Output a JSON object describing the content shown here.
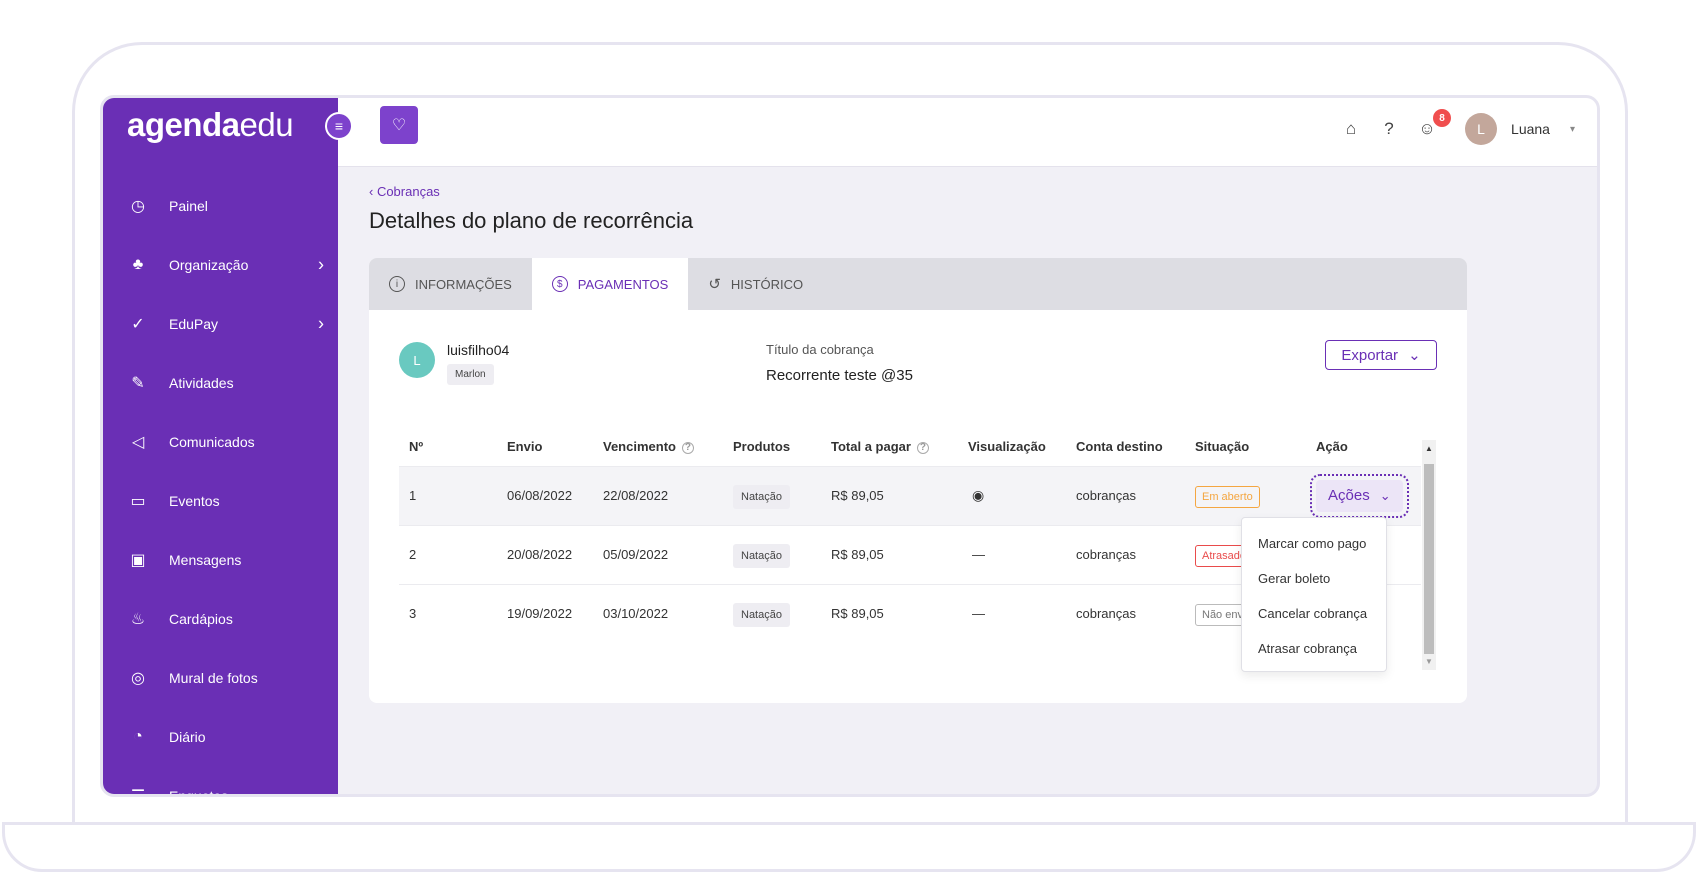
{
  "sidebar": {
    "logo_bold": "agenda",
    "logo_light": "edu",
    "toggle_icon": "≡",
    "items": [
      {
        "label": "Painel",
        "icon": "dashboard-icon",
        "glyph": "◷",
        "chevron": ""
      },
      {
        "label": "Organização",
        "icon": "hierarchy-icon",
        "glyph": "♣",
        "chevron": "›"
      },
      {
        "label": "EduPay",
        "icon": "check-icon",
        "glyph": "✓",
        "chevron": "›"
      },
      {
        "label": "Atividades",
        "icon": "pencil-icon",
        "glyph": "✎",
        "chevron": ""
      },
      {
        "label": "Comunicados",
        "icon": "megaphone-icon",
        "glyph": "◁",
        "chevron": ""
      },
      {
        "label": "Eventos",
        "icon": "calendar-icon",
        "glyph": "▭",
        "chevron": ""
      },
      {
        "label": "Mensagens",
        "icon": "chat-icon",
        "glyph": "▣",
        "chevron": ""
      },
      {
        "label": "Cardápios",
        "icon": "cutlery-icon",
        "glyph": "♨",
        "chevron": ""
      },
      {
        "label": "Mural de fotos",
        "icon": "camera-icon",
        "glyph": "◎",
        "chevron": ""
      },
      {
        "label": "Diário",
        "icon": "timer-icon",
        "glyph": "◔",
        "chevron": ""
      },
      {
        "label": "Enquetes",
        "icon": "list-icon",
        "glyph": "☰",
        "chevron": ""
      }
    ]
  },
  "topbar": {
    "brand_glyph": "♡",
    "gift_glyph": "⌂",
    "help_glyph": "?",
    "chat_glyph": "☺",
    "notification_count": "8",
    "avatar_letter": "L",
    "user_name": "Luana",
    "caret": "▾"
  },
  "page": {
    "breadcrumb": "‹  Cobranças",
    "title": "Detalhes do plano de recorrência"
  },
  "tabs": [
    {
      "label": "INFORMAÇÕES",
      "glyph": "i"
    },
    {
      "label": "PAGAMENTOS",
      "glyph": "$"
    },
    {
      "label": "HISTÓRICO",
      "glyph": "↺"
    }
  ],
  "student": {
    "avatar_letter": "L",
    "username": "luisfilho04",
    "tag": "Marlon"
  },
  "charge": {
    "label": "Título da cobrança",
    "value": "Recorrente teste @35"
  },
  "export": {
    "label": "Exportar",
    "caret": "⌄"
  },
  "table": {
    "headers": {
      "n": "Nº",
      "envio": "Envio",
      "vencimento": "Vencimento",
      "produtos": "Produtos",
      "total": "Total a pagar",
      "visualizacao": "Visualização",
      "conta": "Conta destino",
      "situacao": "Situação",
      "acao": "Ação",
      "help": "?"
    },
    "rows": [
      {
        "n": "1",
        "envio": "06/08/2022",
        "vencimento": "22/08/2022",
        "produto": "Natação",
        "total": "R$ 89,05",
        "visualizacao": "◉",
        "conta": "cobranças",
        "situacao": "Em aberto"
      },
      {
        "n": "2",
        "envio": "20/08/2022",
        "vencimento": "05/09/2022",
        "produto": "Natação",
        "total": "R$ 89,05",
        "visualizacao": "—",
        "conta": "cobranças",
        "situacao": "Atrasado"
      },
      {
        "n": "3",
        "envio": "19/09/2022",
        "vencimento": "03/10/2022",
        "produto": "Natação",
        "total": "R$ 89,05",
        "visualizacao": "—",
        "conta": "cobranças",
        "situacao": "Não enviad"
      }
    ],
    "action_label": "Ações",
    "action_caret": "⌄",
    "scroll_up": "▲",
    "scroll_down": "▼"
  },
  "dropdown": {
    "options": [
      "Marcar como pago",
      "Gerar boleto",
      "Cancelar cobrança",
      "Atrasar cobrança"
    ]
  }
}
